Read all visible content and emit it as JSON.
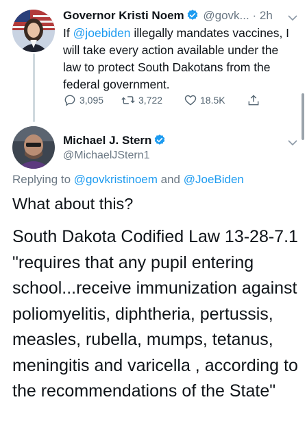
{
  "tweet1": {
    "author_name": "Governor Kristi Noem",
    "handle": "@govk...",
    "time_sep": "·",
    "time": "2h",
    "text_parts": {
      "before": "If ",
      "mention": "@joebiden",
      "after": " illegally mandates vaccines, I will take every action available under the law to protect South Dakotans from the federal government."
    },
    "reply_count": "3,095",
    "retweet_count": "3,722",
    "like_count": "18.5K"
  },
  "tweet2": {
    "author_name": "Michael J. Stern",
    "handle": "@MichaelJStern1",
    "replying_prefix": "Replying to ",
    "replying_user1": "@govkristinoem",
    "replying_and": " and ",
    "replying_user2": "@JoeBiden",
    "paragraph1": "What about this?",
    "paragraph2": "South Dakota Codified Law 13-28-7.1 \"requires that any pupil entering school...receive immunization against poliomyelitis, diphtheria, pertussis, measles, rubella, mumps, tetanus, meningitis and varicella , according to the recommendations of the State\""
  },
  "colors": {
    "link": "#1d9bf0",
    "verified": "#1d9bf0",
    "muted": "#6b7884"
  },
  "icons": [
    "verified-badge-icon",
    "chevron-down-icon",
    "reply-icon",
    "retweet-icon",
    "like-icon",
    "share-icon"
  ]
}
